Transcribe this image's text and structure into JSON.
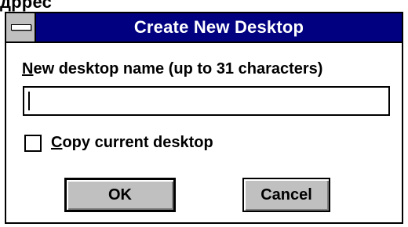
{
  "window": {
    "title": "Create New Desktop",
    "above_text": "дррес"
  },
  "form": {
    "name_label_mnemonic": "N",
    "name_label_rest": "ew desktop name (up to 31 characters)",
    "name_value": "",
    "copy_label_mnemonic": "C",
    "copy_label_rest": "opy current desktop",
    "copy_checked": false
  },
  "buttons": {
    "ok_label": "OK",
    "cancel_label": "Cancel"
  },
  "colors": {
    "titlebar": "#000080",
    "button_face": "#c0c0c0"
  },
  "icons": {
    "system_menu": "system-menu-icon"
  }
}
